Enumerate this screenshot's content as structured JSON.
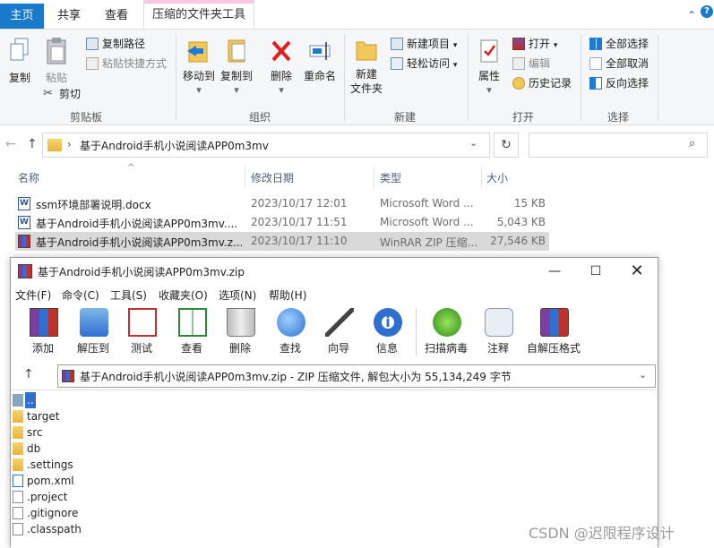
{
  "explorer": {
    "tabs": [
      "主页",
      "共享",
      "查看",
      "压缩的文件夹工具"
    ],
    "ribbon": {
      "clipboard": {
        "copy": "复制",
        "paste": "粘贴",
        "copy_path": "复制路径",
        "paste_shortcut": "粘贴快捷方式",
        "cut": "剪切",
        "label": "剪贴板"
      },
      "organize": {
        "move_to": "移动到",
        "copy_to": "复制到",
        "delete": "删除",
        "rename": "重命名",
        "label": "组织"
      },
      "new": {
        "new_folder_line1": "新建",
        "new_folder_line2": "文件夹",
        "new_item": "新建项目",
        "easy_access": "轻松访问",
        "label": "新建"
      },
      "open": {
        "properties": "属性",
        "open": "打开",
        "edit": "编辑",
        "history": "历史记录",
        "label": "打开"
      },
      "select": {
        "select_all": "全部选择",
        "select_none": "全部取消",
        "invert": "反向选择",
        "label": "选择"
      }
    },
    "address": {
      "path": "基于Android手机小说阅读APP0m3mv"
    },
    "columns": [
      "名称",
      "修改日期",
      "类型",
      "大小"
    ],
    "files": [
      {
        "name": "ssm环境部署说明.docx",
        "date": "2023/10/17 12:01",
        "type": "Microsoft Word ...",
        "size": "15 KB",
        "icon": "word-icon"
      },
      {
        "name": "基于Android手机小说阅读APP0m3mv....",
        "date": "2023/10/17 11:51",
        "type": "Microsoft Word ...",
        "size": "5,043 KB",
        "icon": "word-icon"
      },
      {
        "name": "基于Android手机小说阅读APP0m3mv.z...",
        "date": "2023/10/17 11:10",
        "type": "WinRAR ZIP 压缩...",
        "size": "27,546 KB",
        "icon": "winrar-icon"
      }
    ]
  },
  "winrar": {
    "title": "基于Android手机小说阅读APP0m3mv.zip",
    "menu": [
      "文件(F)",
      "命令(C)",
      "工具(S)",
      "收藏夹(O)",
      "选项(N)",
      "帮助(H)"
    ],
    "toolbar": [
      "添加",
      "解压到",
      "测试",
      "查看",
      "删除",
      "查找",
      "向导",
      "信息",
      "扫描病毒",
      "注释",
      "自解压格式"
    ],
    "path": "基于Android手机小说阅读APP0m3mv.zip - ZIP 压缩文件, 解包大小为 55,134,249 字节",
    "entries": [
      {
        "name": "..",
        "kind": "up"
      },
      {
        "name": "target",
        "kind": "folder"
      },
      {
        "name": "src",
        "kind": "folder"
      },
      {
        "name": "db",
        "kind": "folder"
      },
      {
        "name": ".settings",
        "kind": "folder"
      },
      {
        "name": "pom.xml",
        "kind": "xml"
      },
      {
        "name": ".project",
        "kind": "file"
      },
      {
        "name": ".gitignore",
        "kind": "file"
      },
      {
        "name": ".classpath",
        "kind": "file"
      }
    ]
  },
  "watermark": "CSDN @迟限程序设计",
  "colors": {
    "accent": "#1979ca",
    "selection": "#d9d9d9",
    "ribbon_bg": "#f5f6f7"
  }
}
